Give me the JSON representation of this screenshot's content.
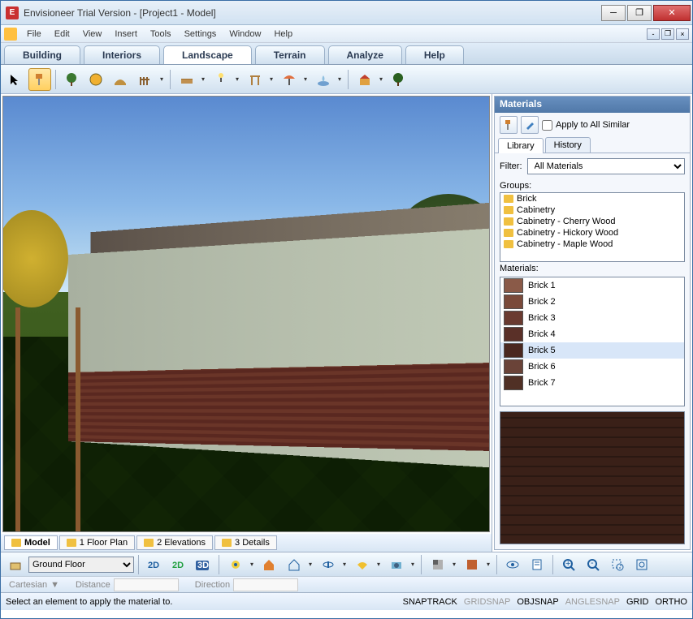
{
  "window": {
    "title": "Envisioneer Trial Version - [Project1 - Model]",
    "app_icon_letter": "E"
  },
  "menu": {
    "items": [
      "File",
      "Edit",
      "View",
      "Insert",
      "Tools",
      "Settings",
      "Window",
      "Help"
    ]
  },
  "main_tabs": {
    "items": [
      "Building",
      "Interiors",
      "Landscape",
      "Terrain",
      "Analyze",
      "Help"
    ],
    "active": "Landscape"
  },
  "view_tabs": {
    "items": [
      "Model",
      "1 Floor Plan",
      "2 Elevations",
      "3 Details"
    ],
    "active": "Model"
  },
  "materials_panel": {
    "title": "Materials",
    "apply_all_label": "Apply to All Similar",
    "tabs": [
      "Library",
      "History"
    ],
    "active_tab": "Library",
    "filter_label": "Filter:",
    "filter_value": "All Materials",
    "groups_label": "Groups:",
    "groups": [
      "Brick",
      "Cabinetry",
      "Cabinetry - Cherry Wood",
      "Cabinetry - Hickory Wood",
      "Cabinetry - Maple Wood"
    ],
    "materials_label": "Materials:",
    "materials": [
      {
        "name": "Brick 1",
        "color": "#8a5a48"
      },
      {
        "name": "Brick 2",
        "color": "#7a4a3a"
      },
      {
        "name": "Brick 3",
        "color": "#6a3a30"
      },
      {
        "name": "Brick 4",
        "color": "#5a3028"
      },
      {
        "name": "Brick 5",
        "color": "#4a2820"
      },
      {
        "name": "Brick 6",
        "color": "#6a4338"
      },
      {
        "name": "Brick 7",
        "color": "#503025"
      }
    ],
    "selected_material": "Brick 5"
  },
  "bottom_toolbar": {
    "location_value": "Ground Floor"
  },
  "coord_bar": {
    "system_label": "Cartesian",
    "distance_label": "Distance",
    "direction_label": "Direction"
  },
  "status": {
    "message": "Select an element to apply the material to.",
    "snaps": [
      {
        "label": "SNAPTRACK",
        "active": true
      },
      {
        "label": "GRIDSNAP",
        "active": false
      },
      {
        "label": "OBJSNAP",
        "active": true
      },
      {
        "label": "ANGLESNAP",
        "active": false
      },
      {
        "label": "GRID",
        "active": true
      },
      {
        "label": "ORTHO",
        "active": true
      }
    ]
  }
}
